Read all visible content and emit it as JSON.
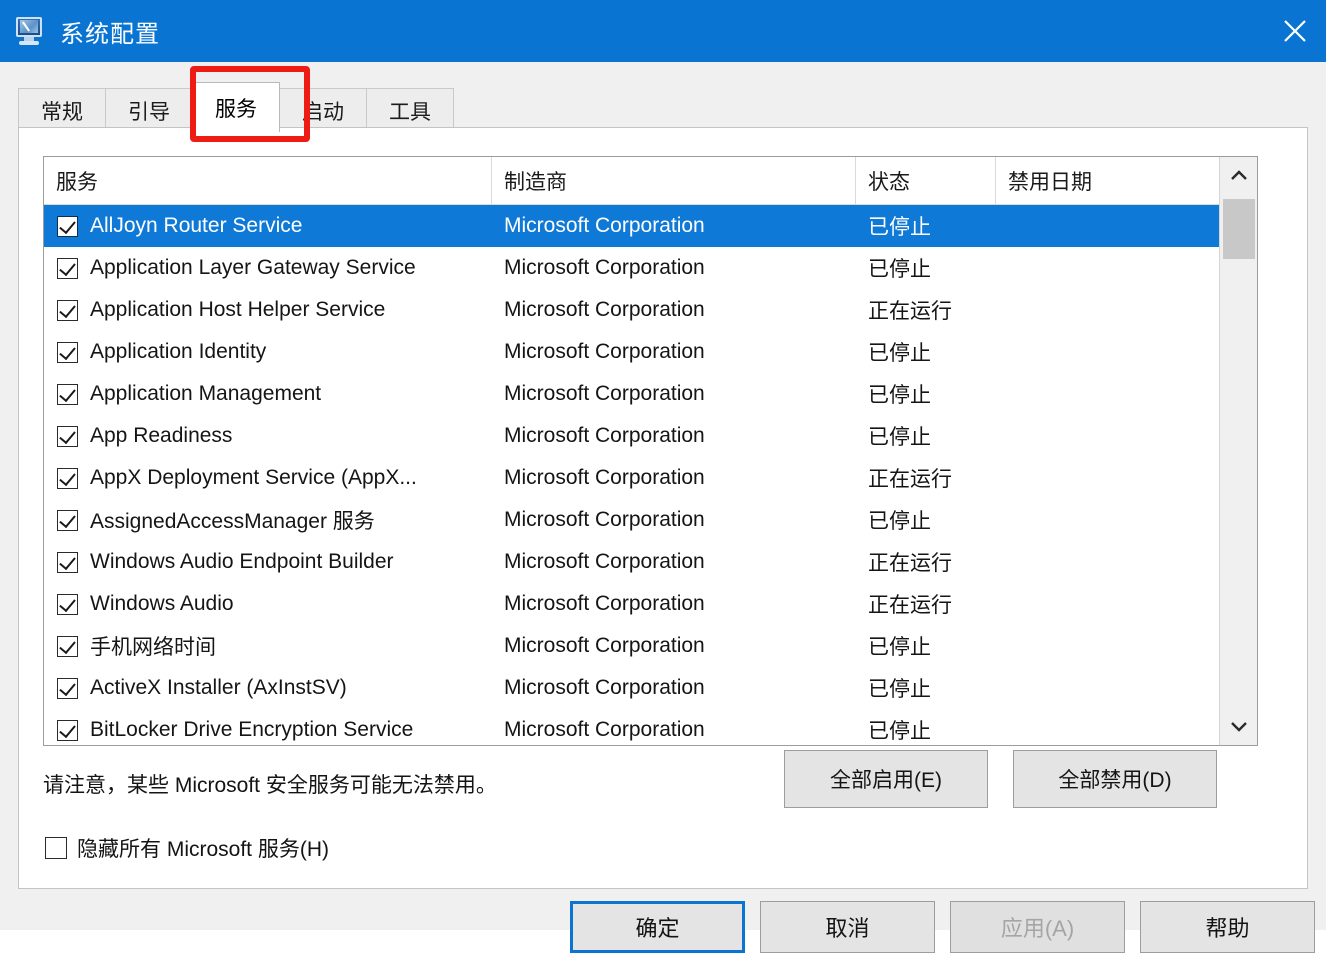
{
  "window": {
    "title": "系统配置",
    "icon": "msconfig-monitor-wrench-icon",
    "close_label": "✕",
    "titlebar_color": "#0a74d2"
  },
  "tabs": [
    {
      "label": "常规",
      "active": false
    },
    {
      "label": "引导",
      "active": false
    },
    {
      "label": "服务",
      "active": true
    },
    {
      "label": "启动",
      "active": false
    },
    {
      "label": "工具",
      "active": false
    }
  ],
  "annotation": {
    "target": "服务",
    "color": "#ee1c15",
    "shape": "rectangle"
  },
  "table": {
    "columns": [
      "服务",
      "制造商",
      "状态",
      "禁用日期"
    ],
    "selected_row_index": 0,
    "selection_color": "#0f79d7",
    "rows": [
      {
        "checked": true,
        "service": "AllJoyn Router Service",
        "maker": "Microsoft Corporation",
        "status": "已停止",
        "date": ""
      },
      {
        "checked": true,
        "service": "Application Layer Gateway Service",
        "maker": "Microsoft Corporation",
        "status": "已停止",
        "date": ""
      },
      {
        "checked": true,
        "service": "Application Host Helper Service",
        "maker": "Microsoft Corporation",
        "status": "正在运行",
        "date": ""
      },
      {
        "checked": true,
        "service": "Application Identity",
        "maker": "Microsoft Corporation",
        "status": "已停止",
        "date": ""
      },
      {
        "checked": true,
        "service": "Application Management",
        "maker": "Microsoft Corporation",
        "status": "已停止",
        "date": ""
      },
      {
        "checked": true,
        "service": "App Readiness",
        "maker": "Microsoft Corporation",
        "status": "已停止",
        "date": ""
      },
      {
        "checked": true,
        "service": "AppX Deployment Service (AppX...",
        "maker": "Microsoft Corporation",
        "status": "正在运行",
        "date": ""
      },
      {
        "checked": true,
        "service": "AssignedAccessManager 服务",
        "maker": "Microsoft Corporation",
        "status": "已停止",
        "date": ""
      },
      {
        "checked": true,
        "service": "Windows Audio Endpoint Builder",
        "maker": "Microsoft Corporation",
        "status": "正在运行",
        "date": ""
      },
      {
        "checked": true,
        "service": "Windows Audio",
        "maker": "Microsoft Corporation",
        "status": "正在运行",
        "date": ""
      },
      {
        "checked": true,
        "service": "手机网络时间",
        "maker": "Microsoft Corporation",
        "status": "已停止",
        "date": ""
      },
      {
        "checked": true,
        "service": "ActiveX Installer (AxInstSV)",
        "maker": "Microsoft Corporation",
        "status": "已停止",
        "date": ""
      },
      {
        "checked": true,
        "service": "BitLocker Drive Encryption Service",
        "maker": "Microsoft Corporation",
        "status": "已停止",
        "date": ""
      }
    ]
  },
  "scrollbar": {
    "up_glyph": "⌃",
    "down_glyph": "⌄",
    "thumb_position": "top"
  },
  "note": "请注意，某些 Microsoft 安全服务可能无法禁用。",
  "actions": {
    "enable_all": "全部启用(E)",
    "disable_all": "全部禁用(D)"
  },
  "hide_microsoft": {
    "label": "隐藏所有 Microsoft 服务(H)",
    "checked": false
  },
  "footer": {
    "ok": "确定",
    "cancel": "取消",
    "apply": "应用(A)",
    "help": "帮助",
    "apply_disabled": true,
    "default_button": "确定"
  }
}
